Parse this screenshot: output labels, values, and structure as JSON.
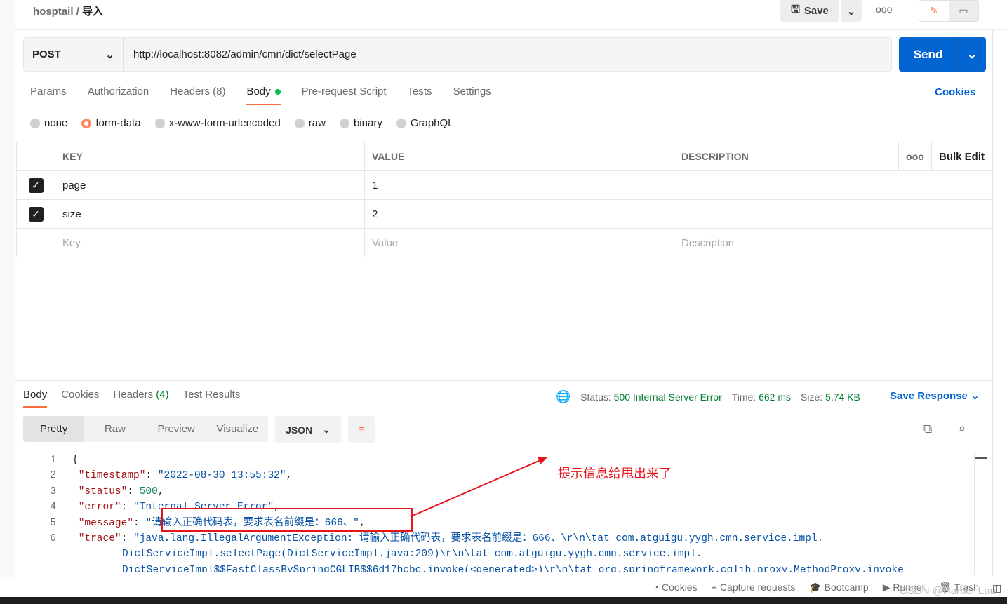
{
  "breadcrumb": {
    "collection": "hosptail",
    "sep": "/",
    "request": "导入"
  },
  "header": {
    "save": "Save",
    "more": "ooo"
  },
  "request": {
    "method": "POST",
    "url": "http://localhost:8082/admin/cmn/dict/selectPage",
    "send": "Send"
  },
  "tabs": [
    "Params",
    "Authorization",
    "Headers (8)",
    "Body",
    "Pre-request Script",
    "Tests",
    "Settings"
  ],
  "cookies": "Cookies",
  "body_types": [
    "none",
    "form-data",
    "x-www-form-urlencoded",
    "raw",
    "binary",
    "GraphQL"
  ],
  "table": {
    "headers": [
      "KEY",
      "VALUE",
      "DESCRIPTION"
    ],
    "bulk_edit": "Bulk Edit",
    "more": "ooo",
    "rows": [
      {
        "key": "page",
        "value": "1"
      },
      {
        "key": "size",
        "value": "2"
      }
    ],
    "placeholders": {
      "key": "Key",
      "value": "Value",
      "description": "Description"
    }
  },
  "response": {
    "tabs": [
      "Body",
      "Cookies",
      "Headers",
      "Test Results"
    ],
    "headers_count": "(4)",
    "status_label": "Status:",
    "status": "500 Internal Server Error",
    "time_label": "Time:",
    "time": "662 ms",
    "size_label": "Size:",
    "size": "5.74 KB",
    "save_response": "Save Response",
    "views": [
      "Pretty",
      "Raw",
      "Preview",
      "Visualize"
    ],
    "format": "JSON"
  },
  "code": {
    "l2k": "\"timestamp\"",
    "l2v": "\"2022-08-30 13:55:32\"",
    "l3k": "\"status\"",
    "l3v": "500",
    "l4k": "\"error\"",
    "l4v": "\"Internal Server Error\"",
    "l5k": "\"message\"",
    "l5v": "\"请输入正确代码表，要求表名前缀是：666、\"",
    "l6k": "\"trace\"",
    "l6v": "\"java.lang.IllegalArgumentException: 请输入正确代码表，要求表名前缀是：666、\\r\\n\\tat com.atguigu.yygh.cmn.service.impl.",
    "l7": "DictServiceImpl.selectPage(DictServiceImpl.java:209)\\r\\n\\tat com.atguigu.yygh.cmn.service.impl.",
    "l8": "DictServiceImpl$$FastClassBySpringCGLIB$$6d17bcbc.invoke(<generated>)\\r\\n\\tat org.springframework.cglib.proxy.MethodProxy.invoke"
  },
  "annotation": "提示信息给甩出来了",
  "footer": [
    "Cookies",
    "Capture requests",
    "Bootcamp",
    "Runner",
    "Trash"
  ],
  "watermark": "CSDN @Harbor Lau"
}
